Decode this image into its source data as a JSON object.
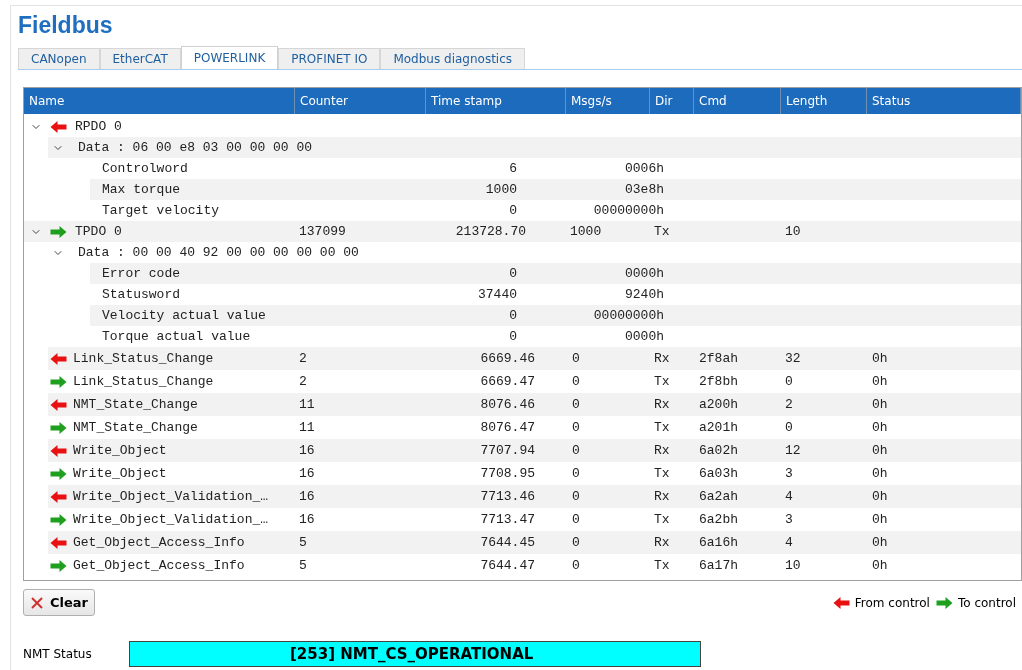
{
  "title": "Fieldbus",
  "tabs": [
    {
      "label": "CANopen",
      "selected": false
    },
    {
      "label": "EtherCAT",
      "selected": false
    },
    {
      "label": "POWERLINK",
      "selected": true
    },
    {
      "label": "PROFINET IO",
      "selected": false
    },
    {
      "label": "Modbus diagnostics",
      "selected": false
    }
  ],
  "table": {
    "columns": [
      "Name",
      "Counter",
      "Time stamp",
      "Msgs/s",
      "Dir",
      "Cmd",
      "Length",
      "Status"
    ],
    "tree": [
      {
        "name": "RPDO 0",
        "kind": "from",
        "expanded": true,
        "children": [
          {
            "name": "Data : 06 00 e8 03 00 00 00 00",
            "expanded": true,
            "children": [
              {
                "name": "Controlword",
                "value": "6",
                "hex": "0006h"
              },
              {
                "name": "Max torque",
                "value": "1000",
                "hex": "03e8h"
              },
              {
                "name": "Target velocity",
                "value": "0",
                "hex": "00000000h"
              }
            ]
          }
        ]
      },
      {
        "name": "TPDO 0",
        "kind": "to",
        "expanded": true,
        "counter": "137099",
        "time_stamp": "213728.70",
        "msgs_per_s": "1000",
        "dir": "Tx",
        "length": "10",
        "children": [
          {
            "name": "Data : 00 00 40 92 00 00 00 00 00 00",
            "expanded": true,
            "children": [
              {
                "name": "Error code",
                "value": "0",
                "hex": "0000h"
              },
              {
                "name": "Statusword",
                "value": "37440",
                "hex": "9240h"
              },
              {
                "name": "Velocity actual value",
                "value": "0",
                "hex": "00000000h"
              },
              {
                "name": "Torque actual value",
                "value": "0",
                "hex": "0000h"
              }
            ]
          }
        ]
      }
    ],
    "messages": [
      {
        "name": "Link_Status_Change",
        "kind": "from",
        "counter": "2",
        "time_stamp": "6669.46",
        "msgs_per_s": "0",
        "dir": "Rx",
        "cmd": "2f8ah",
        "length": "32",
        "status": "0h"
      },
      {
        "name": "Link_Status_Change",
        "kind": "to",
        "counter": "2",
        "time_stamp": "6669.47",
        "msgs_per_s": "0",
        "dir": "Tx",
        "cmd": "2f8bh",
        "length": "0",
        "status": "0h"
      },
      {
        "name": "NMT_State_Change",
        "kind": "from",
        "counter": "11",
        "time_stamp": "8076.46",
        "msgs_per_s": "0",
        "dir": "Rx",
        "cmd": "a200h",
        "length": "2",
        "status": "0h"
      },
      {
        "name": "NMT_State_Change",
        "kind": "to",
        "counter": "11",
        "time_stamp": "8076.47",
        "msgs_per_s": "0",
        "dir": "Tx",
        "cmd": "a201h",
        "length": "0",
        "status": "0h"
      },
      {
        "name": "Write_Object",
        "kind": "from",
        "counter": "16",
        "time_stamp": "7707.94",
        "msgs_per_s": "0",
        "dir": "Rx",
        "cmd": "6a02h",
        "length": "12",
        "status": "0h"
      },
      {
        "name": "Write_Object",
        "kind": "to",
        "counter": "16",
        "time_stamp": "7708.95",
        "msgs_per_s": "0",
        "dir": "Tx",
        "cmd": "6a03h",
        "length": "3",
        "status": "0h"
      },
      {
        "name": "Write_Object_Validation_…",
        "kind": "from",
        "counter": "16",
        "time_stamp": "7713.46",
        "msgs_per_s": "0",
        "dir": "Rx",
        "cmd": "6a2ah",
        "length": "4",
        "status": "0h"
      },
      {
        "name": "Write_Object_Validation_…",
        "kind": "to",
        "counter": "16",
        "time_stamp": "7713.47",
        "msgs_per_s": "0",
        "dir": "Tx",
        "cmd": "6a2bh",
        "length": "3",
        "status": "0h"
      },
      {
        "name": "Get_Object_Access_Info",
        "kind": "from",
        "counter": "5",
        "time_stamp": "7644.45",
        "msgs_per_s": "0",
        "dir": "Rx",
        "cmd": "6a16h",
        "length": "4",
        "status": "0h"
      },
      {
        "name": "Get_Object_Access_Info",
        "kind": "to",
        "counter": "5",
        "time_stamp": "7644.47",
        "msgs_per_s": "0",
        "dir": "Tx",
        "cmd": "6a17h",
        "length": "10",
        "status": "0h"
      }
    ]
  },
  "clear_button": "Clear",
  "legend": [
    {
      "kind": "from",
      "label": "From control"
    },
    {
      "kind": "to",
      "label": "To control"
    }
  ],
  "nmt_status": {
    "label": "NMT Status",
    "value": "[253] NMT_CS_OPERATIONAL"
  }
}
